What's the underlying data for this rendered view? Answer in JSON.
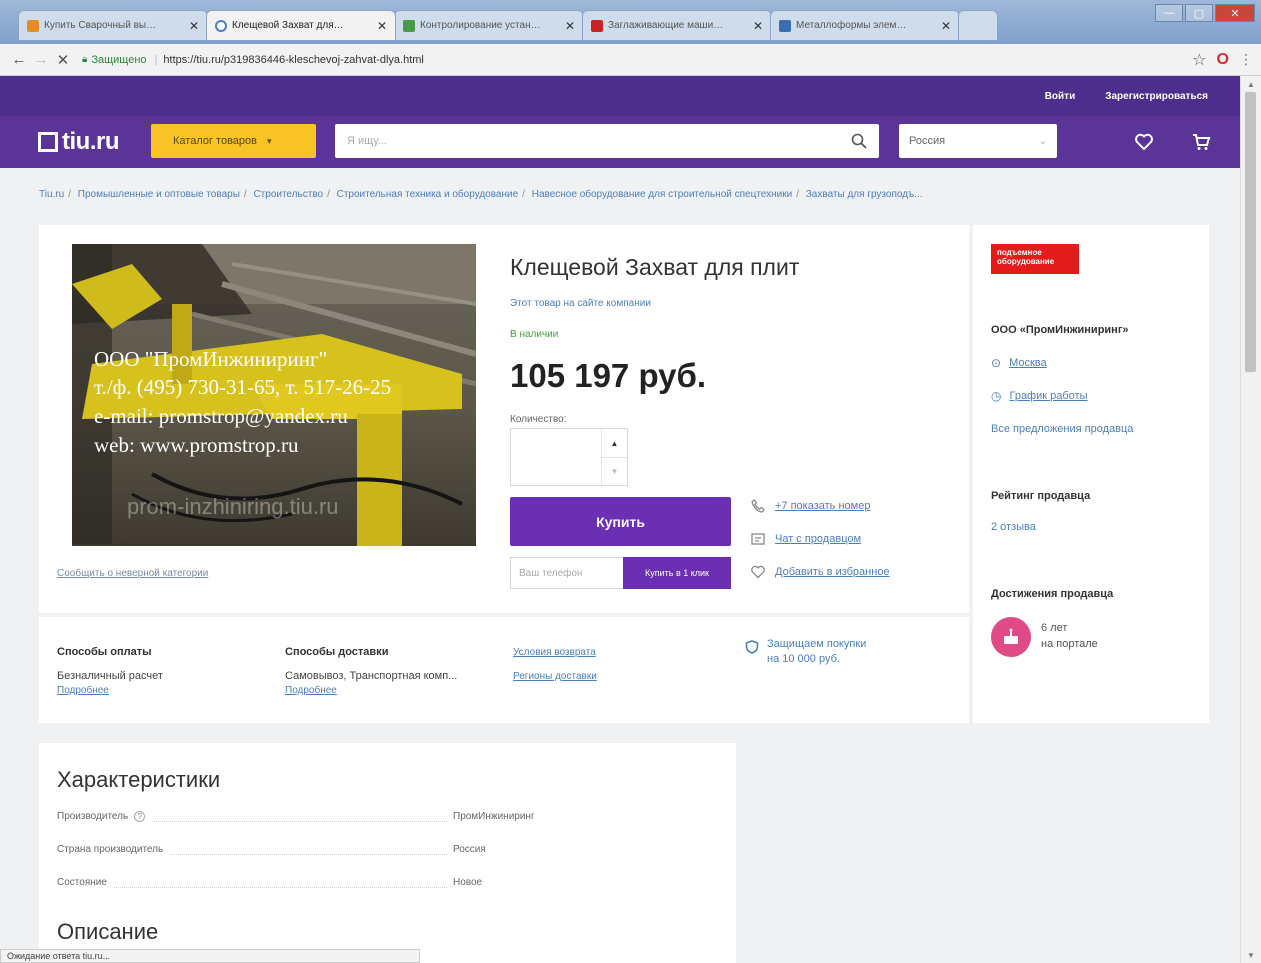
{
  "browser": {
    "tabs": [
      {
        "title": "Купить Сварочный вы…",
        "fav_color": "#e58b2a"
      },
      {
        "title": "Клещевой Захват для…",
        "fav_color": "#4a7fbf"
      },
      {
        "title": "Контролирование устан…",
        "fav_color": "#4a9a4a"
      },
      {
        "title": "Заглаживающие маши…",
        "fav_color": "#cc2222"
      },
      {
        "title": "Металлоформы элем…",
        "fav_color": "#3a6eb0"
      }
    ],
    "secure_label": "Защищено",
    "url": "https://tiu.ru/p319836446-kleschevoj-zahvat-dlya.html"
  },
  "header": {
    "login": "Войти",
    "register": "Зарегистрироваться",
    "logo": "tiu.ru",
    "catalog": "Каталог товаров",
    "search_placeholder": "Я ищу...",
    "region": "Россия"
  },
  "breadcrumb": [
    "Tiu.ru",
    "Промышленные и оптовые товары",
    "Строительство",
    "Строительная техника и оборудование",
    "Навесное оборудование для строительной спецтехники",
    "Захваты для грузоподъ..."
  ],
  "product": {
    "title": "Клещевой Захват для плит",
    "company_link": "Этот товар на сайте компании",
    "availability": "В наличии",
    "price": "105 197 руб.",
    "qty_label": "Количество:",
    "buy": "Купить",
    "phone_placeholder": "Ваш телефон",
    "oneclick": "Купить в 1 клик",
    "show_phone": "+7 показать номер",
    "chat": "Чат с продавцом",
    "favorite": "Добавить в избранное",
    "report": "Сообщить о неверной категории",
    "watermark": {
      "line1": "ООО \"ПромИнжиниринг\"",
      "line2": "т./ф. (495) 730-31-65, т. 517-26-25",
      "line3": "e-mail: promstrop@yandex.ru",
      "line4": "web:   www.promstrop.ru",
      "line5": "prom-inzhiniring.tiu.ru"
    }
  },
  "info": {
    "payment_h": "Способы оплаты",
    "payment_v": "Безналичный расчет",
    "delivery_h": "Способы доставки",
    "delivery_v": "Самовывоз, Транспортная комп...",
    "more": "Подробнее",
    "returns": "Условия возврата",
    "regions": "Регионы доставки",
    "protect_line1": "Защищаем покупки",
    "protect_line2": "на 10 000 руб."
  },
  "seller": {
    "badge": "подъемное оборудование",
    "name": "ООО «ПромИнжиниринг»",
    "city": "Москва",
    "schedule": "График работы",
    "all_offers": "Все предложения продавца",
    "rating_h": "Рейтинг продавца",
    "reviews": "2 отзыва",
    "achievements_h": "Достижения продавца",
    "years": "6 лет",
    "on_portal": "на портале"
  },
  "characteristics": {
    "title": "Характеристики",
    "rows": [
      {
        "key": "Производитель",
        "value": "ПромИнжиниринг"
      },
      {
        "key": "Страна производитель",
        "value": "Россия"
      },
      {
        "key": "Состояние",
        "value": "Новое"
      }
    ]
  },
  "description_title": "Описание",
  "status_text": "Ожидание ответа tiu.ru...",
  "colors": {
    "brand_purple": "#5a3497",
    "catalog_yellow": "#f7c325",
    "buy_purple": "#6b2fb3",
    "link_blue": "#4a7fbf"
  }
}
